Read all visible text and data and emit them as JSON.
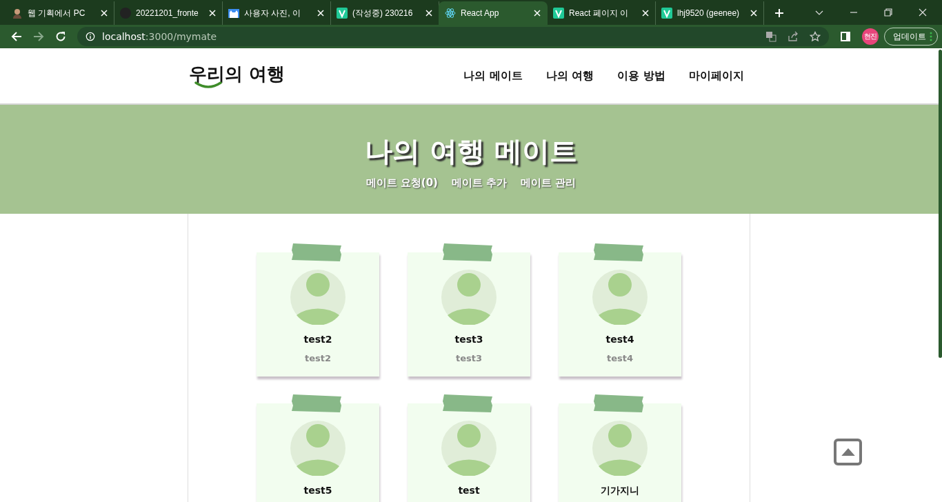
{
  "browser": {
    "tabs": [
      {
        "title": "웹 기획에서 PC",
        "selected": false
      },
      {
        "title": "20221201_fronte",
        "selected": false
      },
      {
        "title": "사용자 사진, 이",
        "selected": false
      },
      {
        "title": "(작성중) 230216",
        "selected": false
      },
      {
        "title": "React App",
        "selected": true
      },
      {
        "title": "React 페이지 이",
        "selected": false
      },
      {
        "title": "lhj9520 (geenee)",
        "selected": false
      }
    ],
    "url_host": "localhost",
    "url_rest": ":3000/mymate",
    "profile": "현진",
    "update_button": "업데이트"
  },
  "site": {
    "logo": "우리의 여행",
    "nav": [
      "나의 메이트",
      "나의 여행",
      "이용 방법",
      "마이페이지"
    ]
  },
  "banner": {
    "title": "나의 여행 메이트",
    "links": [
      "메이트 요청(0)",
      "메이트 추가",
      "메이트 관리"
    ]
  },
  "mates": [
    {
      "name": "test2",
      "id": "test2"
    },
    {
      "name": "test3",
      "id": "test3"
    },
    {
      "name": "test4",
      "id": "test4"
    },
    {
      "name": "test5"
    },
    {
      "name": "test"
    },
    {
      "name": "기가지니"
    }
  ]
}
